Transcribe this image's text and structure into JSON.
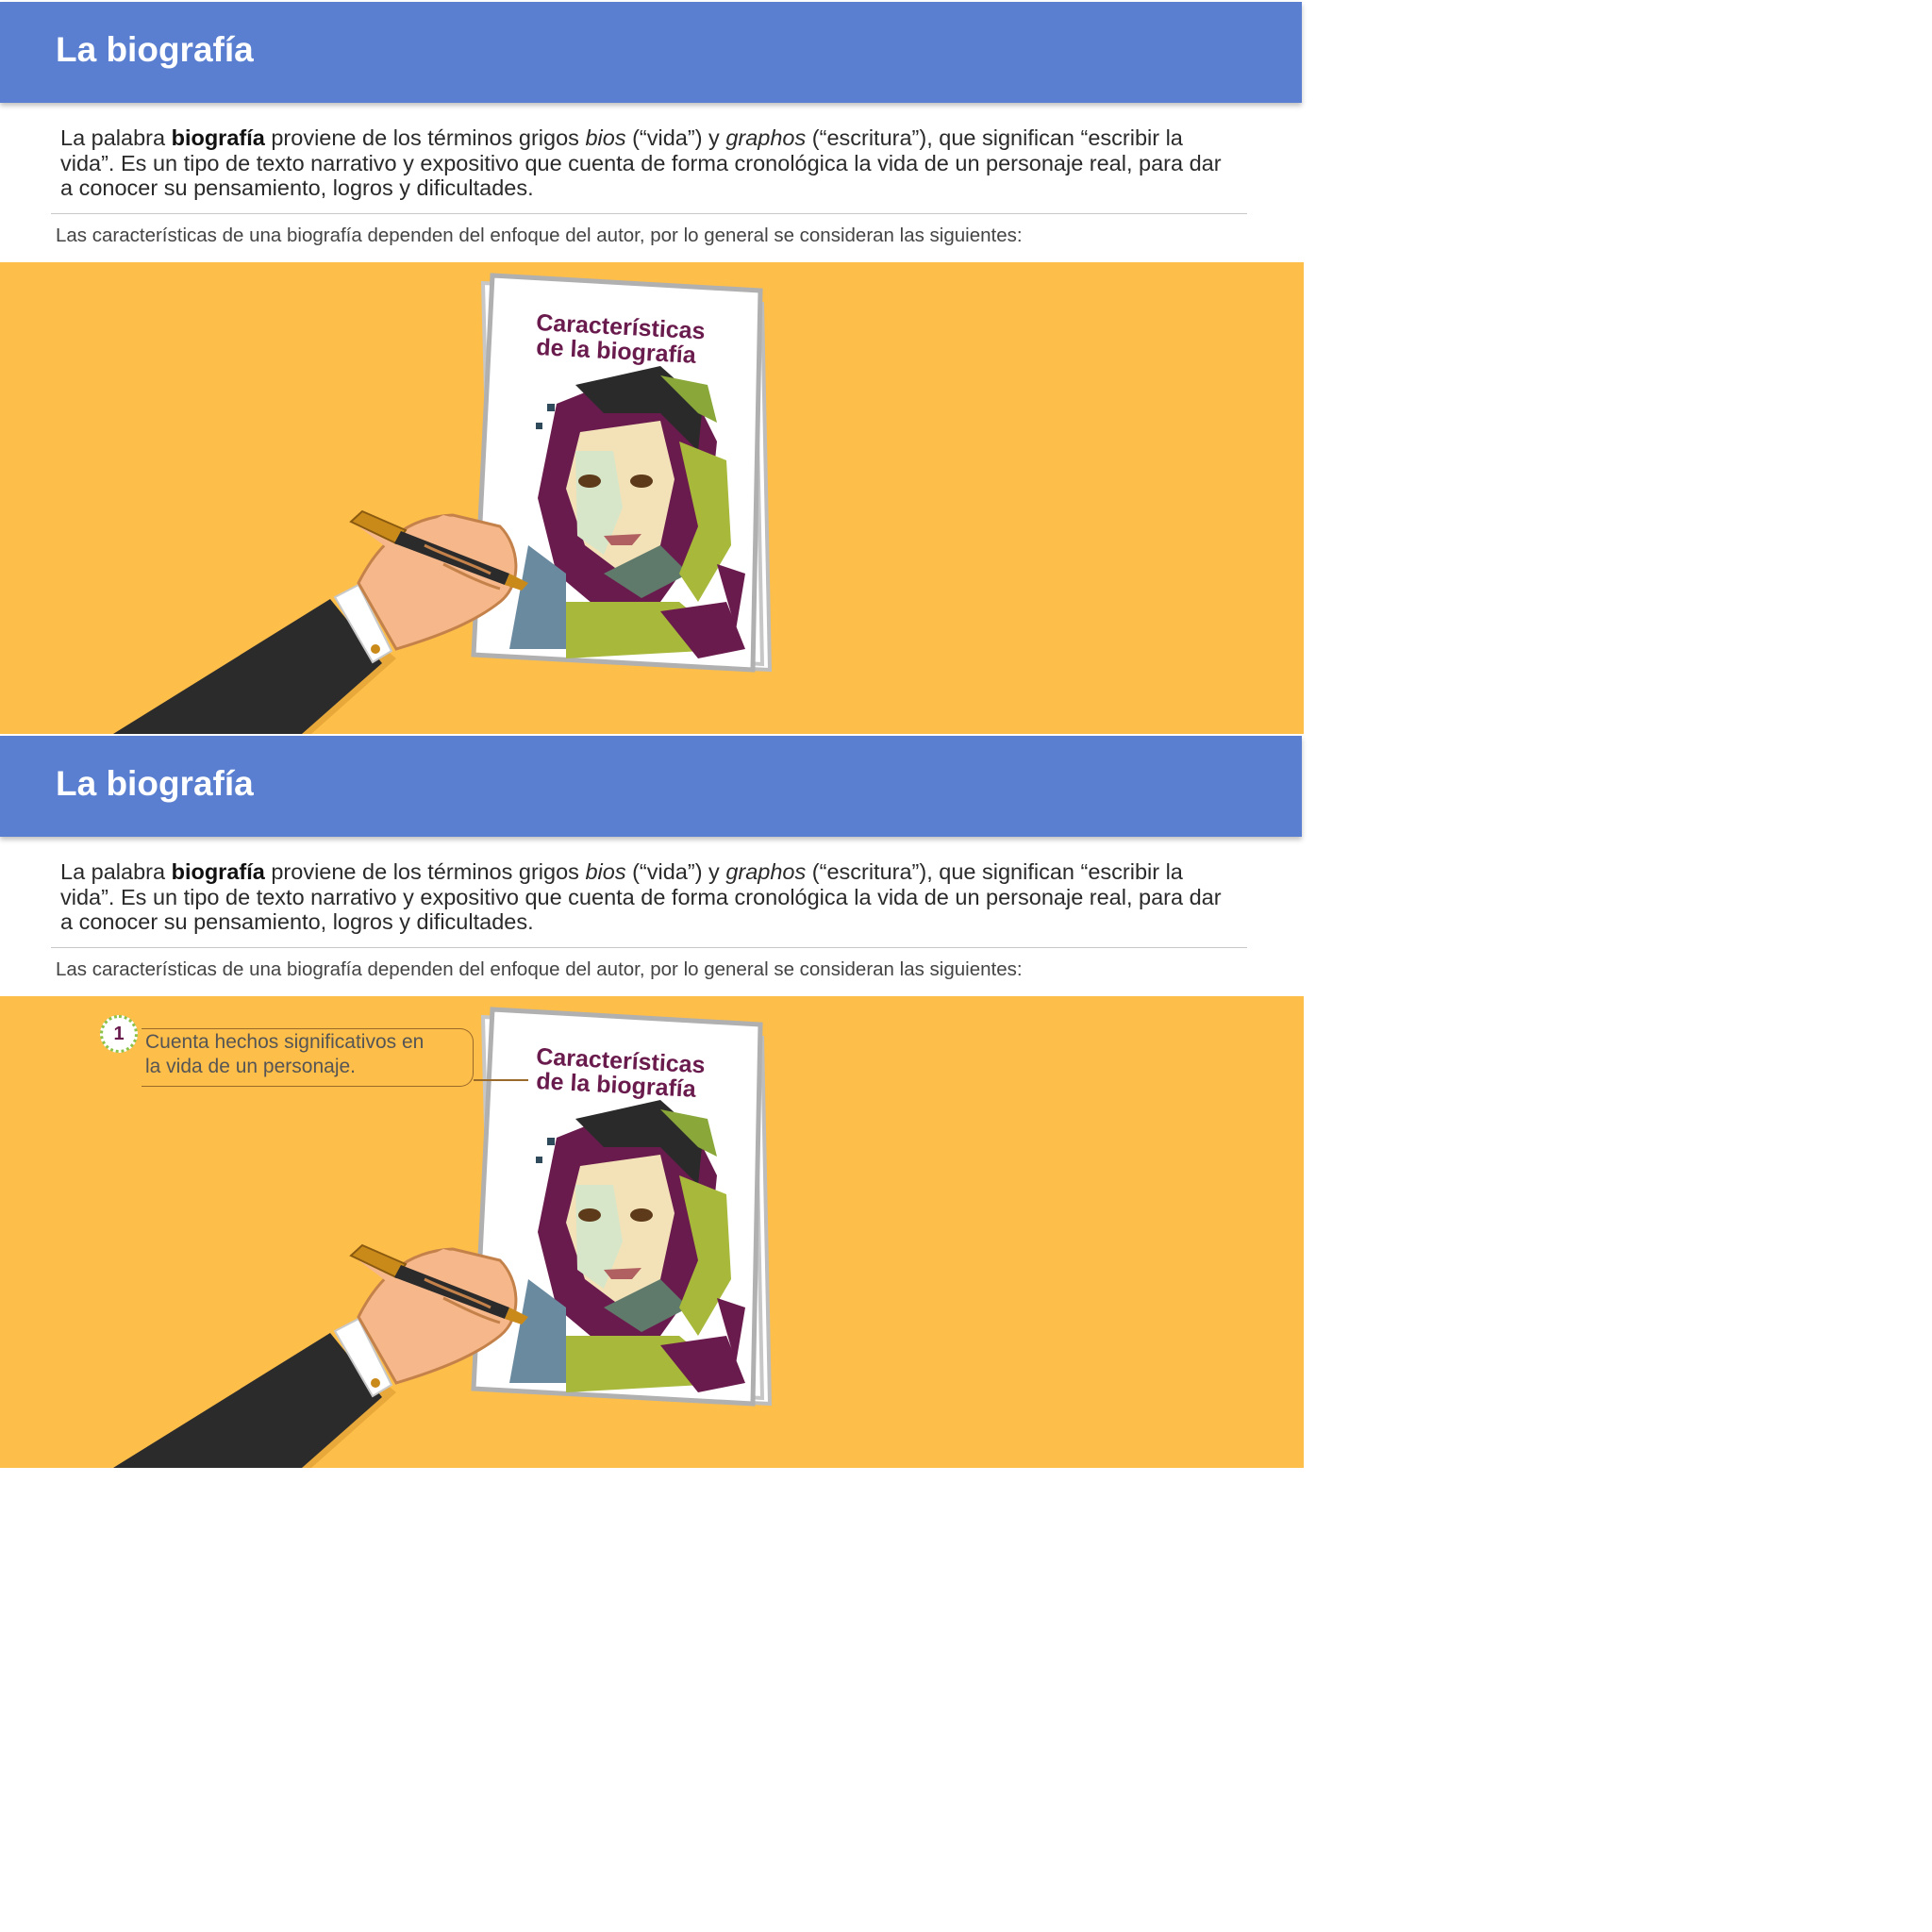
{
  "slides": [
    {
      "title": "La biografía",
      "intro": {
        "p1": "La palabra ",
        "bold": "biografía",
        "p2": " proviene de los términos grigos ",
        "i1": "bios",
        "p3": " (“vida”) y ",
        "i2": "graphos",
        "p4": " (“escritura”), que significan “escribir la vida”. Es un tipo de texto narrativo y expositivo que cuenta de forma cronológica la vida de un personaje real, para dar a conocer su pensamiento, logros y dificultades."
      },
      "caption": "Las características de una biografía dependen del enfoque del autor, por lo general se consideran las siguientes:",
      "book_title_1": "Características",
      "book_title_2": "de la biografía"
    },
    {
      "title": "La biografía",
      "intro": {
        "p1": "La palabra ",
        "bold": "biografía",
        "p2": " proviene de los términos grigos ",
        "i1": "bios",
        "p3": " (“vida”) y ",
        "i2": "graphos",
        "p4": " (“escritura”), que significan “escribir la vida”. Es un tipo de texto narrativo y expositivo que cuenta de forma cronológica la vida de un personaje real, para dar a conocer su pensamiento, logros y dificultades."
      },
      "caption": "Las características de una biografía dependen del enfoque del autor, por lo general se consideran las siguientes:",
      "book_title_1": "Características",
      "book_title_2": "de la biografía",
      "callout": {
        "number": "1",
        "text": "Cuenta hechos significativos en la vida de un personaje."
      }
    }
  ],
  "colors": {
    "header": "#5a7fd0",
    "band": "#febe4a",
    "title_text": "#6a1b4d"
  }
}
